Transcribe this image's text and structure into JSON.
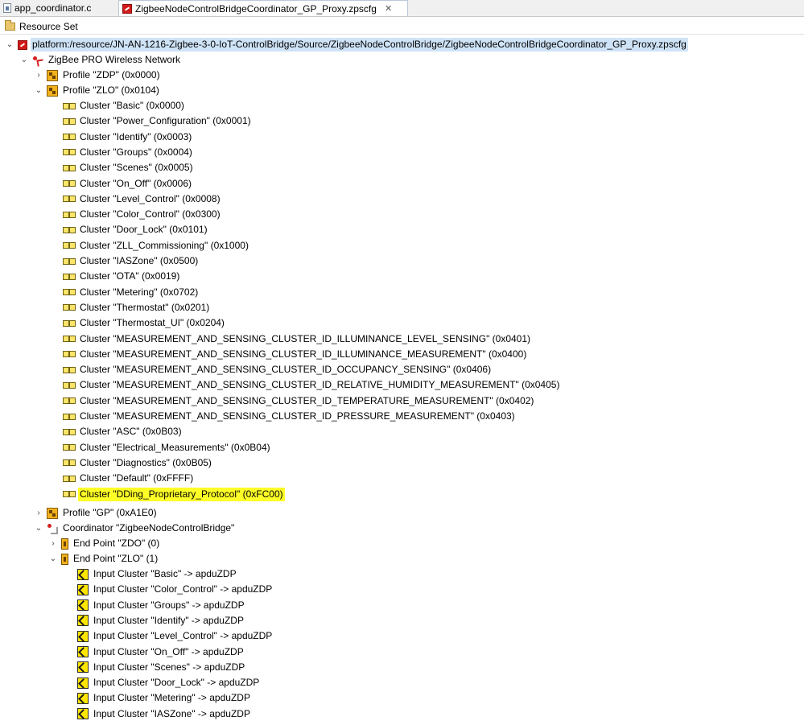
{
  "tabs": [
    {
      "label": "app_coordinator.c",
      "icon": "c-file-icon",
      "active": false
    },
    {
      "label": "ZigbeeNodeControlBridgeCoordinator_GP_Proxy.zpscfg",
      "icon": "zpscfg-file-icon",
      "active": true,
      "close_glyph": "✕"
    }
  ],
  "header": {
    "title": "Resource Set"
  },
  "tree": {
    "root": "platform:/resource/JN-AN-1216-Zigbee-3-0-IoT-ControlBridge/Source/ZigbeeNodeControlBridge/ZigbeeNodeControlBridgeCoordinator_GP_Proxy.zpscfg",
    "network": "ZigBee PRO Wireless Network",
    "profile_zdp": "Profile \"ZDP\" (0x0000)",
    "profile_zlo": "Profile \"ZLO\" (0x0104)",
    "clusters": [
      "Cluster \"Basic\" (0x0000)",
      "Cluster \"Power_Configuration\" (0x0001)",
      "Cluster \"Identify\" (0x0003)",
      "Cluster \"Groups\" (0x0004)",
      "Cluster \"Scenes\" (0x0005)",
      "Cluster \"On_Off\" (0x0006)",
      "Cluster \"Level_Control\" (0x0008)",
      "Cluster \"Color_Control\" (0x0300)",
      "Cluster \"Door_Lock\" (0x0101)",
      "Cluster \"ZLL_Commissioning\" (0x1000)",
      "Cluster \"IASZone\" (0x0500)",
      "Cluster \"OTA\" (0x0019)",
      "Cluster \"Metering\" (0x0702)",
      "Cluster \"Thermostat\" (0x0201)",
      "Cluster \"Thermostat_UI\" (0x0204)",
      "Cluster \"MEASUREMENT_AND_SENSING_CLUSTER_ID_ILLUMINANCE_LEVEL_SENSING\" (0x0401)",
      "Cluster \"MEASUREMENT_AND_SENSING_CLUSTER_ID_ILLUMINANCE_MEASUREMENT\" (0x0400)",
      "Cluster \"MEASUREMENT_AND_SENSING_CLUSTER_ID_OCCUPANCY_SENSING\" (0x0406)",
      "Cluster \"MEASUREMENT_AND_SENSING_CLUSTER_ID_RELATIVE_HUMIDITY_MEASUREMENT\" (0x0405)",
      "Cluster \"MEASUREMENT_AND_SENSING_CLUSTER_ID_TEMPERATURE_MEASUREMENT\" (0x0402)",
      "Cluster \"MEASUREMENT_AND_SENSING_CLUSTER_ID_PRESSURE_MEASUREMENT\" (0x0403)",
      "Cluster \"ASC\" (0x0B03)",
      "Cluster \"Electrical_Measurements\" (0x0B04)",
      "Cluster \"Diagnostics\" (0x0B05)",
      "Cluster \"Default\" (0xFFFF)",
      "Cluster \"DDing_Proprietary_Protocol\" (0xFC00)"
    ],
    "profile_gp": "Profile \"GP\" (0xA1E0)",
    "coordinator": "Coordinator \"ZigbeeNodeControlBridge\"",
    "endpoint_zdo": "End Point \"ZDO\" (0)",
    "endpoint_zlo": "End Point \"ZLO\" (1)",
    "input_clusters": [
      "Input Cluster \"Basic\" -> apduZDP",
      "Input Cluster \"Color_Control\" -> apduZDP",
      "Input Cluster \"Groups\" -> apduZDP",
      "Input Cluster \"Identify\" -> apduZDP",
      "Input Cluster \"Level_Control\" -> apduZDP",
      "Input Cluster \"On_Off\" -> apduZDP",
      "Input Cluster \"Scenes\" -> apduZDP",
      "Input Cluster \"Door_Lock\" -> apduZDP",
      "Input Cluster \"Metering\" -> apduZDP",
      "Input Cluster \"IASZone\" -> apduZDP"
    ],
    "expand_glyph": "⌄",
    "collapse_glyph": "›"
  },
  "colors": {
    "selection": "#cfe3f7",
    "highlight": "#ffff28",
    "tab_border": "#b9c8d9"
  }
}
